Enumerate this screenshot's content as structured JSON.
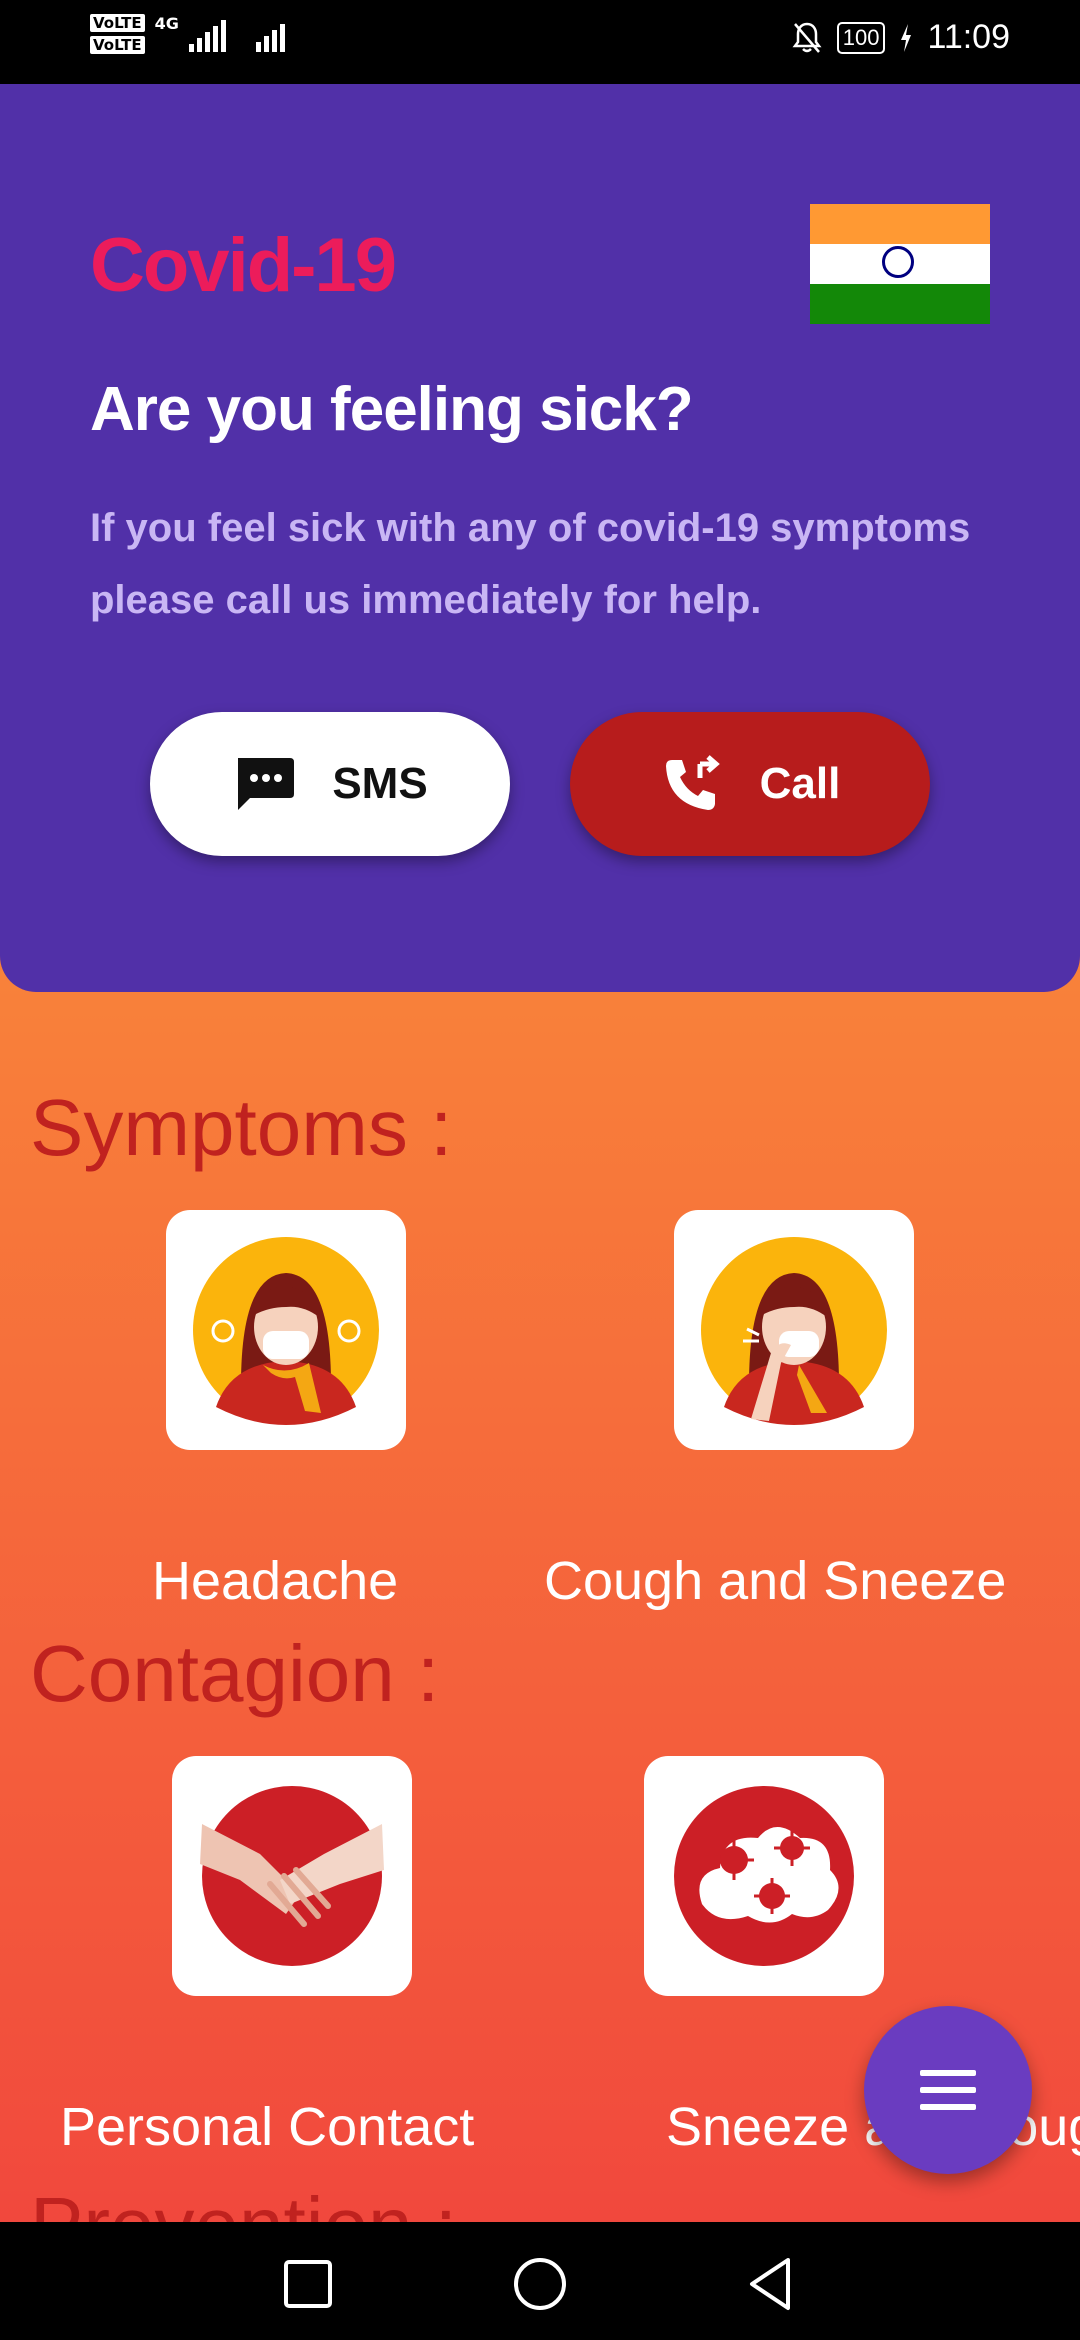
{
  "status_bar": {
    "sim1": "VoLTE",
    "sim2": "VoLTE",
    "network": "4G",
    "battery": "100",
    "time": "11:09"
  },
  "hero": {
    "title": "Covid-19",
    "flag": "india-flag",
    "subtitle": "Are you feeling sick?",
    "text": "If you feel sick with any of covid-19 symptoms please call us immediately for help.",
    "sms_label": "SMS",
    "call_label": "Call"
  },
  "sections": {
    "symptoms": {
      "title": "Symptoms :",
      "items": [
        {
          "label": "Headache",
          "icon": "headache-illustration"
        },
        {
          "label": "Cough and Sneeze",
          "icon": "cough-illustration"
        }
      ]
    },
    "contagion": {
      "title": "Contagion :",
      "items": [
        {
          "label": "Personal Contact",
          "icon": "handshake-illustration"
        },
        {
          "label": "Sneeze and Cough",
          "icon": "virus-cloud-illustration"
        }
      ]
    },
    "prevention": {
      "title": "Prevention :"
    }
  },
  "colors": {
    "hero_bg": "#5130a8",
    "accent_title": "#ec1c5b",
    "call_btn": "#b71c1c",
    "section_title": "#c0221f",
    "fab": "#6a3cc0"
  }
}
